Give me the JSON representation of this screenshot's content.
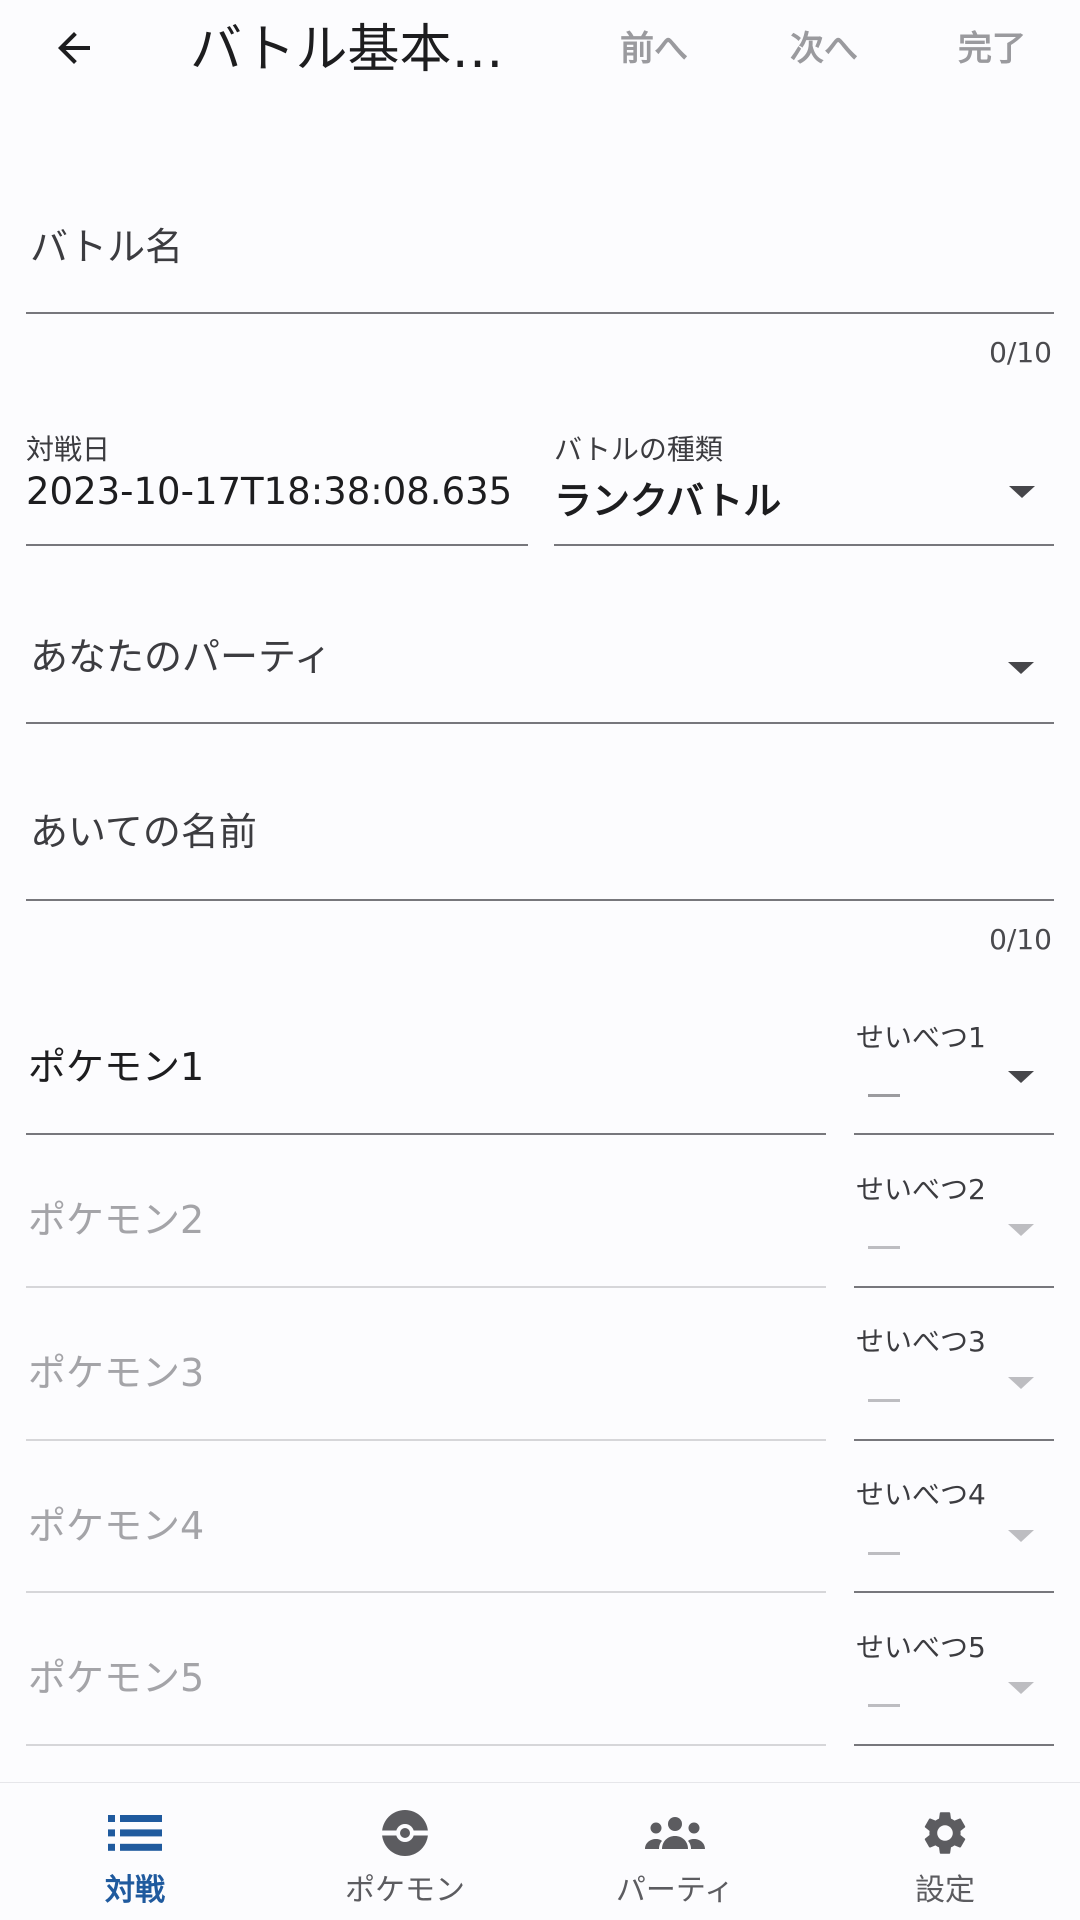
{
  "appbar": {
    "title": "バトル基本…",
    "prev_label": "前へ",
    "next_label": "次へ",
    "done_label": "完了"
  },
  "battle_name": {
    "label": "バトル名",
    "counter": "0/10"
  },
  "battle_date": {
    "label": "対戦日",
    "value": "2023-10-17T18:38:08.635"
  },
  "battle_type": {
    "label": "バトルの種類",
    "value": "ランクバトル"
  },
  "your_party": {
    "label": "あなたのパーティ"
  },
  "opponent_name": {
    "label": "あいての名前",
    "counter": "0/10"
  },
  "pokemon": [
    {
      "label": "ポケモン1",
      "gender_label": "せいべつ1",
      "gender_value": "—",
      "enabled": true
    },
    {
      "label": "ポケモン2",
      "gender_label": "せいべつ2",
      "gender_value": "—",
      "enabled": false
    },
    {
      "label": "ポケモン3",
      "gender_label": "せいべつ3",
      "gender_value": "—",
      "enabled": false
    },
    {
      "label": "ポケモン4",
      "gender_label": "せいべつ4",
      "gender_value": "—",
      "enabled": false
    },
    {
      "label": "ポケモン5",
      "gender_label": "せいべつ5",
      "gender_value": "—",
      "enabled": false
    }
  ],
  "nav": {
    "items": [
      {
        "label": "対戦",
        "icon": "list-icon",
        "active": true
      },
      {
        "label": "ポケモン",
        "icon": "pokeball-icon",
        "active": false
      },
      {
        "label": "パーティ",
        "icon": "group-icon",
        "active": false
      },
      {
        "label": "設定",
        "icon": "gear-icon",
        "active": false
      }
    ]
  },
  "colors": {
    "accent": "#1f5a9e",
    "text": "#1d1d1f",
    "disabled_text": "#a4a4a8",
    "action_text": "#9a9a9e",
    "underline": "#77777c"
  }
}
